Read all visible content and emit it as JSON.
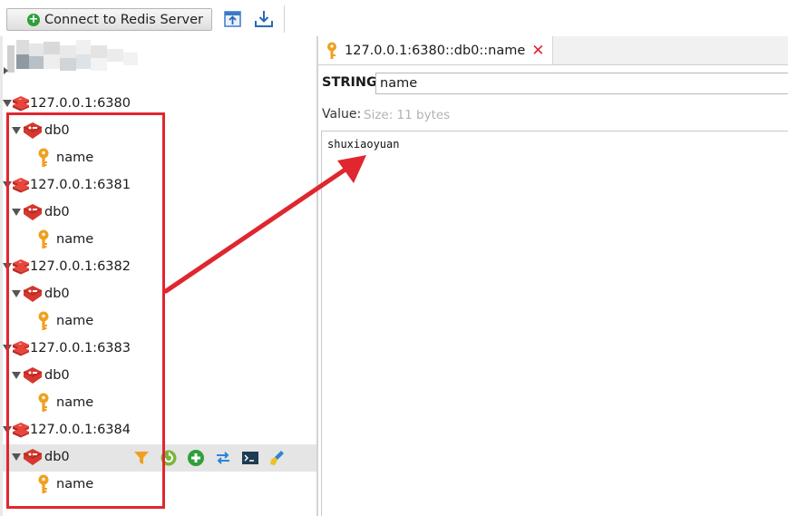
{
  "toolbar": {
    "connect_label": "Connect to Redis Server",
    "icons": [
      "import-icon",
      "export-icon"
    ]
  },
  "tree": {
    "servers": [
      {
        "host": "127.0.0.1:6380",
        "db": "db0",
        "key": "name"
      },
      {
        "host": "127.0.0.1:6381",
        "db": "db0",
        "key": "name"
      },
      {
        "host": "127.0.0.1:6382",
        "db": "db0",
        "key": "name"
      },
      {
        "host": "127.0.0.1:6383",
        "db": "db0",
        "key": "name"
      },
      {
        "host": "127.0.0.1:6384",
        "db": "db0",
        "key": "name"
      }
    ],
    "db_actions": [
      "filter-icon",
      "reload-icon",
      "add-key-icon",
      "refresh-icon",
      "console-icon",
      "flush-icon"
    ]
  },
  "tab": {
    "title": "127.0.0.1:6380::db0::name"
  },
  "editor": {
    "type_label": "STRING:",
    "key_name": "name",
    "value_label": "Value:",
    "value_size": "Size: 11 bytes",
    "value": "shuxiaoyuan"
  },
  "colors": {
    "annotation_red": "#e0262f",
    "redis_red": "#d6372e",
    "key_orange": "#f0a020"
  }
}
